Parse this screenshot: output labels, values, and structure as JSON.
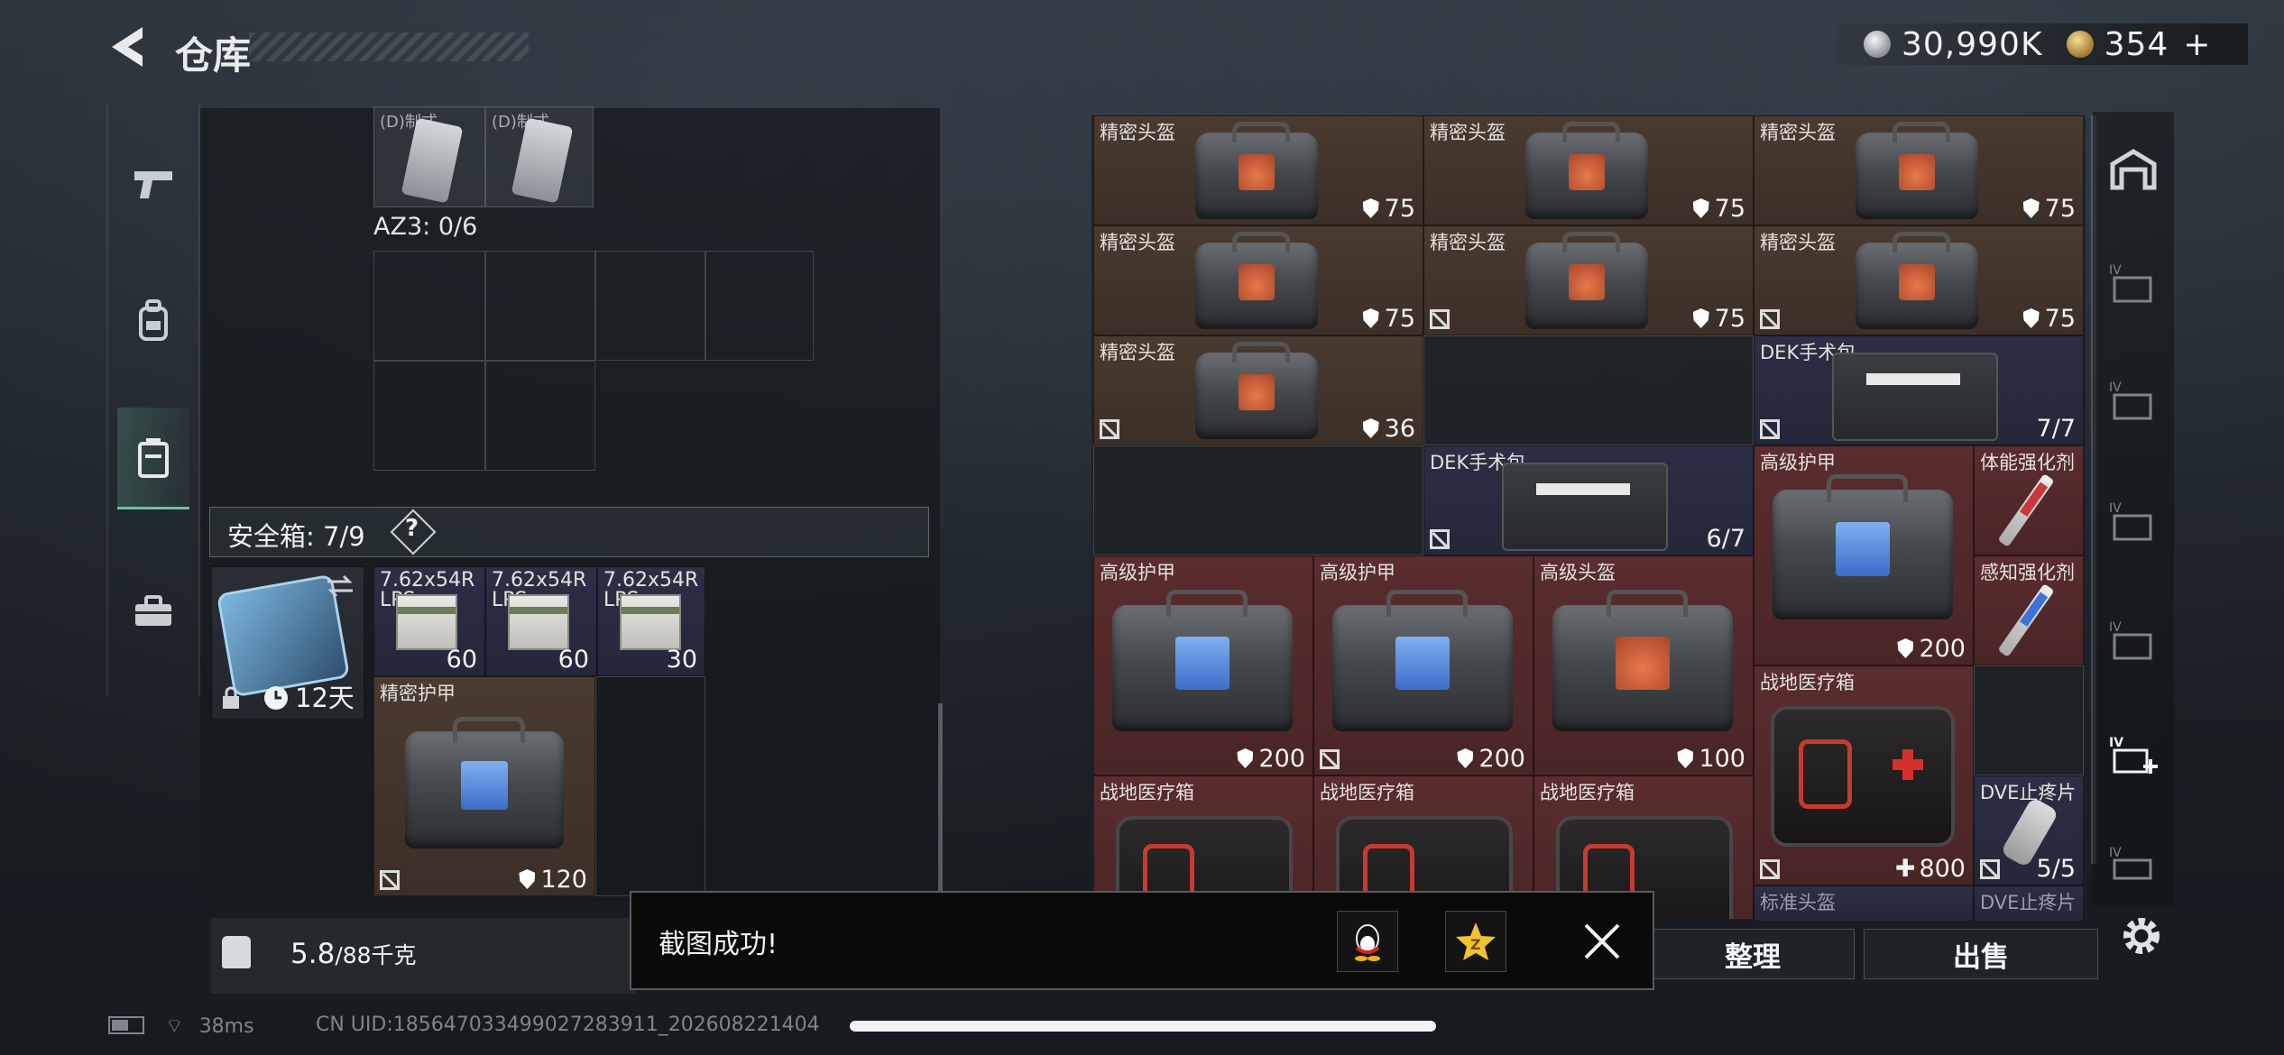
{
  "header": {
    "title": "仓库",
    "silver": "30,990K",
    "gold": "354",
    "gold_plus": "+"
  },
  "left": {
    "az_label": "AZ3: 0/6",
    "top_cards": [
      {
        "label": "(D)制式…"
      },
      {
        "label": "(D)制式…"
      }
    ],
    "safe_label": "安全箱: 7/9",
    "safe_help": "?",
    "safe_case_timer": "12天",
    "ammo": [
      {
        "name": "7.62x54R",
        "sub": "LPS",
        "qty": "60"
      },
      {
        "name": "7.62x54R",
        "sub": "LPS",
        "qty": "60"
      },
      {
        "name": "7.62x54R",
        "sub": "LPS",
        "qty": "30"
      }
    ],
    "armor": {
      "name": "精密护甲",
      "value": "120"
    },
    "weight": "5.8",
    "weight_max": "/88千克"
  },
  "right": {
    "items": [
      {
        "name": "精密头盔",
        "value": "75"
      },
      {
        "name": "精密头盔",
        "value": "75"
      },
      {
        "name": "精密头盔",
        "value": "75"
      },
      {
        "name": "精密头盔",
        "value": "75"
      },
      {
        "name": "精密头盔",
        "value": "75"
      },
      {
        "name": "精密头盔",
        "value": "75"
      },
      {
        "name": "精密头盔",
        "value": "36"
      },
      {
        "name": "DEK手术包",
        "value": "7/7"
      },
      {
        "name": "DEK手术包",
        "value": "6/7"
      },
      {
        "name": "高级护甲",
        "value": "200"
      },
      {
        "name": "体能强化剂",
        "value": ""
      },
      {
        "name": "感知强化剂",
        "value": ""
      },
      {
        "name": "高级护甲",
        "value": "200"
      },
      {
        "name": "高级护甲",
        "value": "200"
      },
      {
        "name": "高级头盔",
        "value": "100"
      },
      {
        "name": "战地医疗箱",
        "value": "800"
      },
      {
        "name": "DVE止疼片",
        "value": "5/5"
      },
      {
        "name": "战地医疗箱",
        "value": ""
      },
      {
        "name": "战地医疗箱",
        "value": ""
      },
      {
        "name": "战地医疗箱",
        "value": ""
      },
      {
        "name": "标准头盔",
        "value": ""
      },
      {
        "name": "DVE止疼片",
        "value": ""
      }
    ],
    "sort_button": "整理",
    "sell_button": "出售",
    "side_label": "IV"
  },
  "toast": {
    "text": "截图成功!"
  },
  "status": {
    "ping": "38ms",
    "uid": "CN UID:1856470334990272839​11_20260822140​4"
  },
  "colors": {
    "accent": "#66c4a0",
    "brown": "#4a3a30",
    "red": "#5a2d2e",
    "navy": "#2c2f45"
  }
}
